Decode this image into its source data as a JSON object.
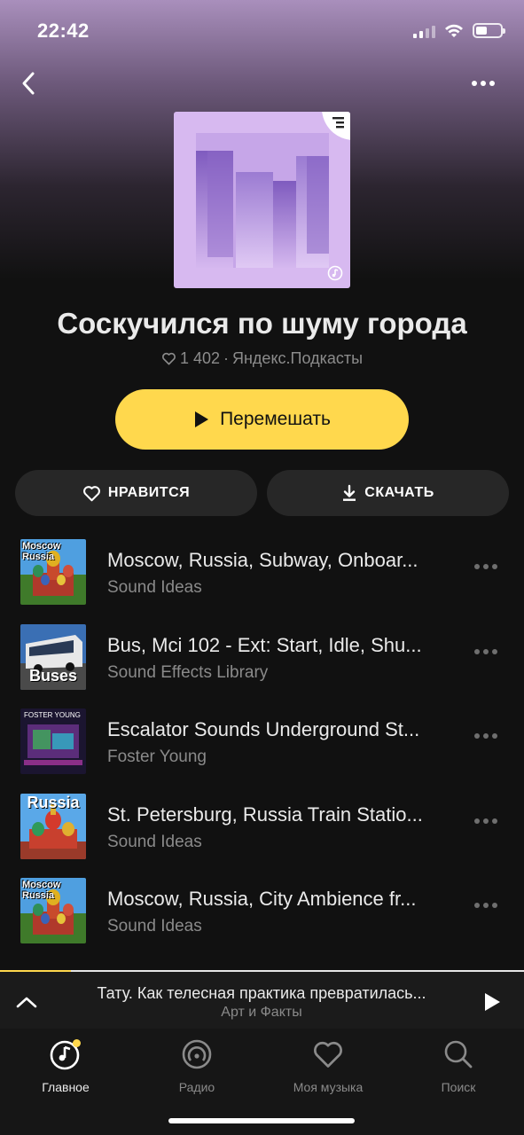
{
  "status_bar": {
    "time": "22:42"
  },
  "header": {
    "icons": {
      "back": "chevron-left-icon",
      "more": "more-horizontal-icon"
    }
  },
  "playlist": {
    "title": "Соскучился по шуму города",
    "likes": "1 402",
    "separator": "·",
    "author": "Яндекс.Подкасты",
    "cover_color": "#d7b9f0"
  },
  "actions": {
    "shuffle_label": "Перемешать",
    "like_label": "НРАВИТСЯ",
    "download_label": "СКАЧАТЬ"
  },
  "tracks": [
    {
      "title": "Moscow, Russia, Subway, Onboar...",
      "artist": "Sound Ideas",
      "cover_caption": "Moscow Russia"
    },
    {
      "title": "Bus, Mci 102 - Ext: Start, Idle, Shu...",
      "artist": "Sound Effects Library",
      "cover_caption": "Buses"
    },
    {
      "title": "Escalator Sounds Underground St...",
      "artist": "Foster Young",
      "cover_caption": "FOSTER YOUNG"
    },
    {
      "title": "St. Petersburg, Russia Train Statio...",
      "artist": "Sound Ideas",
      "cover_caption": "Russia"
    },
    {
      "title": "Moscow, Russia, City Ambience fr...",
      "artist": "Sound Ideas",
      "cover_caption": "Moscow Russia"
    }
  ],
  "mini_player": {
    "title": "Тату. Как телесная практика превратилась...",
    "subtitle": "Арт и Факты"
  },
  "tabbar": {
    "home": "Главное",
    "radio": "Радио",
    "my_music": "Моя музыка",
    "search": "Поиск"
  },
  "colors": {
    "accent": "#ffd84d",
    "background": "#111111"
  }
}
